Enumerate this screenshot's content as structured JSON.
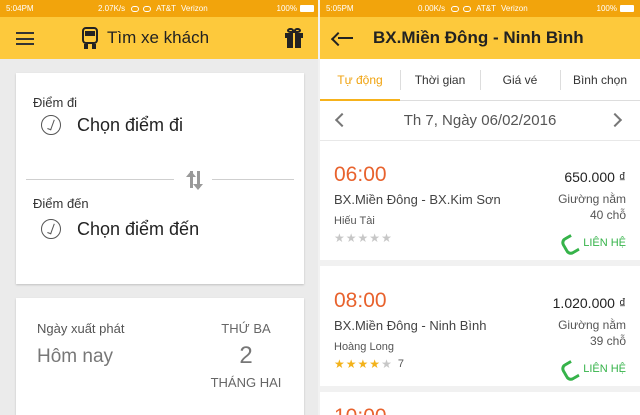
{
  "left": {
    "status": {
      "time": "5:04PM",
      "speed": "2.07K/s",
      "carrier": "AT&T",
      "carrier2": "Verizon",
      "battery": "100%"
    },
    "appbar": {
      "title": "Tìm xe khách",
      "menu_icon": "hamburger-icon",
      "bus_icon": "bus-icon",
      "gift_icon": "gift-icon"
    },
    "from": {
      "label": "Điểm đi",
      "value": "Chọn điểm đi"
    },
    "to": {
      "label": "Điểm đến",
      "value": "Chọn điểm đến"
    },
    "date": {
      "label": "Ngày xuất phát",
      "value": "Hôm nay",
      "weekday": "THỨ BA",
      "day": "2",
      "month": "THÁNG HAI"
    }
  },
  "right": {
    "status": {
      "time": "5:05PM",
      "speed": "0.00K/s",
      "carrier": "AT&T",
      "carrier2": "Verizon",
      "battery": "100%"
    },
    "appbar": {
      "title": "BX.Miền Đông - Ninh Bình"
    },
    "tabs": [
      {
        "label": "Tự động",
        "active": true
      },
      {
        "label": "Thời gian",
        "active": false
      },
      {
        "label": "Giá vé",
        "active": false
      },
      {
        "label": "Bình chọn",
        "active": false
      }
    ],
    "date_text": "Th 7, Ngày 06/02/2016",
    "trips": [
      {
        "time": "06:00",
        "route": "BX.Miền Đông - BX.Kim Sơn",
        "operator": "Hiếu Tài",
        "stars": 0,
        "rating_count": "",
        "price": "650.000 ₫",
        "seat_type": "Giường nằm",
        "seats": "40 chỗ",
        "contact": "LIÊN HỆ"
      },
      {
        "time": "08:00",
        "route": "BX.Miền Đông - Ninh Bình",
        "operator": "Hoàng Long",
        "stars": 4,
        "rating_count": "7",
        "price": "1.020.000 ₫",
        "seat_type": "Giường nằm",
        "seats": "39 chỗ",
        "contact": "LIÊN HỆ"
      }
    ],
    "peek_time": "10:00"
  },
  "colors": {
    "appbar": "#fdc93c",
    "statusbar": "#f2a40c",
    "time_accent": "#e8622d",
    "contact_green": "#36b34a",
    "star_gold": "#f3b21a"
  }
}
